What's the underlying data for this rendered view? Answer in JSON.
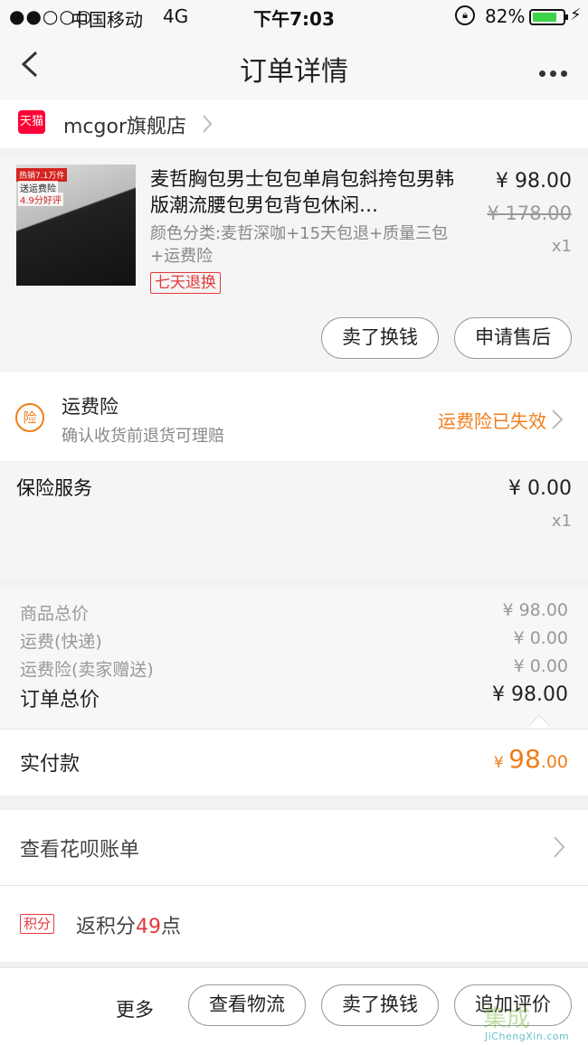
{
  "status_bar": {
    "signal": "●●○○○",
    "carrier": "中国移动",
    "network": "4G",
    "time": "下午7:03",
    "battery_pct": "82%",
    "battery_level": 0.82
  },
  "nav": {
    "title": "订单详情"
  },
  "shop": {
    "tmall_label": "天猫",
    "name": "mcgor旗舰店"
  },
  "item": {
    "thumb_tag1": "热销7.1万件",
    "thumb_tag2": "送运费险",
    "thumb_tag3": "4.9分好评",
    "title": "麦哲胸包男士包包单肩包斜挎包男韩版潮流腰包男包背包休闲…",
    "sku": "颜色分类:麦哲深咖+15天包退+质量三包+运费险",
    "badge": "七天退换",
    "price": "¥ 98.00",
    "original_price": "¥ 178.00",
    "qty": "x1",
    "btn_sell": "卖了换钱",
    "btn_after_sale": "申请售后"
  },
  "insurance": {
    "icon_label": "险",
    "title": "运费险",
    "subtitle": "确认收货前退货可理赔",
    "status": "运费险已失效"
  },
  "service": {
    "label": "保险服务",
    "price": "¥ 0.00",
    "qty": "x1"
  },
  "summary": {
    "goods_label": "商品总价",
    "goods_value": "¥ 98.00",
    "shipping_label": "运费(快递)",
    "shipping_value": "¥ 0.00",
    "freight_ins_label": "运费险(卖家赠送)",
    "freight_ins_value": "¥ 0.00",
    "total_label": "订单总价",
    "total_value": "¥ 98.00"
  },
  "paid": {
    "label": "实付款",
    "currency": "¥ ",
    "integer": "98",
    "decimal": ".00"
  },
  "huabei": {
    "label": "查看花呗账单"
  },
  "points": {
    "tag": "积分",
    "prefix": "返积分",
    "number": "49",
    "suffix": "点"
  },
  "bottom_bar": {
    "more": "更多",
    "logistics": "查看物流",
    "sell": "卖了换钱",
    "review": "追加评价"
  },
  "watermark": {
    "main": "集成",
    "sub": "JiChengXin.com"
  },
  "colors": {
    "accent": "#f07d1a",
    "red": "#e4393c",
    "tmall": "#ff0036"
  }
}
